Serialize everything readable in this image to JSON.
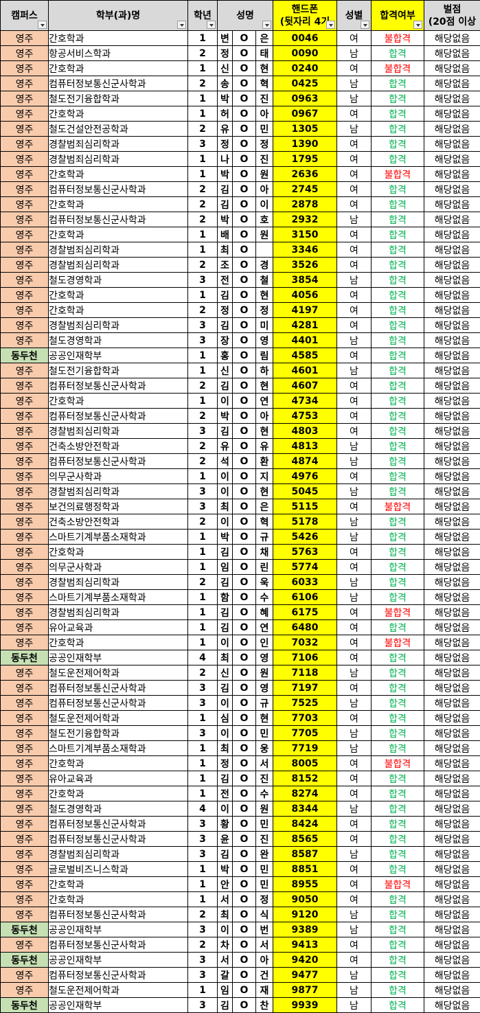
{
  "headers": {
    "campus": "캠퍼스",
    "dept": "학부(과)명",
    "grade": "학년",
    "name": "성명",
    "phone_line1": "핸드폰",
    "phone_line2": "(뒷자리 4기",
    "gender": "성별",
    "result": "합격여부",
    "penalty_line1": "벌점",
    "penalty_line2": "(20점 이상"
  },
  "colors": {
    "yeongju": "#f8cbad",
    "dongducheon": "#c6e0b4",
    "phone": "#ffff00",
    "pass": "#00b050",
    "fail": "#ff0000"
  },
  "rows": [
    {
      "campus": "영주",
      "dept": "간호학과",
      "grade": "1",
      "n1": "변",
      "n2": "O",
      "n3": "은",
      "phone": "0046",
      "gender": "여",
      "result": "불합격",
      "penalty": "해당없음"
    },
    {
      "campus": "영주",
      "dept": "항공서비스학과",
      "grade": "2",
      "n1": "정",
      "n2": "O",
      "n3": "태",
      "phone": "0090",
      "gender": "남",
      "result": "합격",
      "penalty": "해당없음"
    },
    {
      "campus": "영주",
      "dept": "간호학과",
      "grade": "1",
      "n1": "신",
      "n2": "O",
      "n3": "현",
      "phone": "0240",
      "gender": "여",
      "result": "불합격",
      "penalty": "해당없음"
    },
    {
      "campus": "영주",
      "dept": "컴퓨터정보통신군사학과",
      "grade": "2",
      "n1": "송",
      "n2": "O",
      "n3": "혁",
      "phone": "0425",
      "gender": "남",
      "result": "합격",
      "penalty": "해당없음"
    },
    {
      "campus": "영주",
      "dept": "철도전기융합학과",
      "grade": "1",
      "n1": "박",
      "n2": "O",
      "n3": "진",
      "phone": "0963",
      "gender": "남",
      "result": "합격",
      "penalty": "해당없음"
    },
    {
      "campus": "영주",
      "dept": "간호학과",
      "grade": "1",
      "n1": "허",
      "n2": "O",
      "n3": "아",
      "phone": "0967",
      "gender": "여",
      "result": "합격",
      "penalty": "해당없음"
    },
    {
      "campus": "영주",
      "dept": "철도건설안전공학과",
      "grade": "2",
      "n1": "유",
      "n2": "O",
      "n3": "민",
      "phone": "1305",
      "gender": "남",
      "result": "합격",
      "penalty": "해당없음"
    },
    {
      "campus": "영주",
      "dept": "경찰범죄심리학과",
      "grade": "3",
      "n1": "정",
      "n2": "O",
      "n3": "정",
      "phone": "1390",
      "gender": "여",
      "result": "합격",
      "penalty": "해당없음"
    },
    {
      "campus": "영주",
      "dept": "경찰범죄심리학과",
      "grade": "1",
      "n1": "나",
      "n2": "O",
      "n3": "진",
      "phone": "1795",
      "gender": "여",
      "result": "합격",
      "penalty": "해당없음"
    },
    {
      "campus": "영주",
      "dept": "간호학과",
      "grade": "1",
      "n1": "박",
      "n2": "O",
      "n3": "원",
      "phone": "2636",
      "gender": "여",
      "result": "불합격",
      "penalty": "해당없음"
    },
    {
      "campus": "영주",
      "dept": "컴퓨터정보통신군사학과",
      "grade": "2",
      "n1": "김",
      "n2": "O",
      "n3": "아",
      "phone": "2745",
      "gender": "여",
      "result": "합격",
      "penalty": "해당없음"
    },
    {
      "campus": "영주",
      "dept": "간호학과",
      "grade": "2",
      "n1": "김",
      "n2": "O",
      "n3": "이",
      "phone": "2878",
      "gender": "여",
      "result": "합격",
      "penalty": "해당없음"
    },
    {
      "campus": "영주",
      "dept": "컴퓨터정보통신군사학과",
      "grade": "2",
      "n1": "박",
      "n2": "O",
      "n3": "호",
      "phone": "2932",
      "gender": "남",
      "result": "합격",
      "penalty": "해당없음"
    },
    {
      "campus": "영주",
      "dept": "간호학과",
      "grade": "1",
      "n1": "배",
      "n2": "O",
      "n3": "원",
      "phone": "3150",
      "gender": "여",
      "result": "합격",
      "penalty": "해당없음"
    },
    {
      "campus": "영주",
      "dept": "경찰범죄심리학과",
      "grade": "1",
      "n1": "최",
      "n2": "O",
      "n3": "",
      "phone": "3346",
      "gender": "여",
      "result": "합격",
      "penalty": "해당없음"
    },
    {
      "campus": "영주",
      "dept": "경찰범죄심리학과",
      "grade": "2",
      "n1": "조",
      "n2": "O",
      "n3": "경",
      "phone": "3526",
      "gender": "여",
      "result": "합격",
      "penalty": "해당없음"
    },
    {
      "campus": "영주",
      "dept": "철도경영학과",
      "grade": "3",
      "n1": "전",
      "n2": "O",
      "n3": "철",
      "phone": "3854",
      "gender": "남",
      "result": "합격",
      "penalty": "해당없음"
    },
    {
      "campus": "영주",
      "dept": "간호학과",
      "grade": "1",
      "n1": "김",
      "n2": "O",
      "n3": "현",
      "phone": "4056",
      "gender": "여",
      "result": "합격",
      "penalty": "해당없음"
    },
    {
      "campus": "영주",
      "dept": "간호학과",
      "grade": "2",
      "n1": "정",
      "n2": "O",
      "n3": "정",
      "phone": "4197",
      "gender": "여",
      "result": "합격",
      "penalty": "해당없음"
    },
    {
      "campus": "영주",
      "dept": "경찰범죄심리학과",
      "grade": "3",
      "n1": "김",
      "n2": "O",
      "n3": "미",
      "phone": "4281",
      "gender": "여",
      "result": "합격",
      "penalty": "해당없음"
    },
    {
      "campus": "영주",
      "dept": "철도경영학과",
      "grade": "3",
      "n1": "장",
      "n2": "O",
      "n3": "영",
      "phone": "4401",
      "gender": "남",
      "result": "합격",
      "penalty": "해당없음"
    },
    {
      "campus": "동두천",
      "dept": "공공인재학부",
      "grade": "1",
      "n1": "홍",
      "n2": "O",
      "n3": "림",
      "phone": "4585",
      "gender": "여",
      "result": "합격",
      "penalty": "해당없음"
    },
    {
      "campus": "영주",
      "dept": "철도전기융합학과",
      "grade": "1",
      "n1": "신",
      "n2": "O",
      "n3": "하",
      "phone": "4601",
      "gender": "남",
      "result": "합격",
      "penalty": "해당없음"
    },
    {
      "campus": "영주",
      "dept": "컴퓨터정보통신군사학과",
      "grade": "2",
      "n1": "김",
      "n2": "O",
      "n3": "현",
      "phone": "4607",
      "gender": "여",
      "result": "합격",
      "penalty": "해당없음"
    },
    {
      "campus": "영주",
      "dept": "간호학과",
      "grade": "1",
      "n1": "이",
      "n2": "O",
      "n3": "연",
      "phone": "4734",
      "gender": "여",
      "result": "합격",
      "penalty": "해당없음"
    },
    {
      "campus": "영주",
      "dept": "컴퓨터정보통신군사학과",
      "grade": "2",
      "n1": "박",
      "n2": "O",
      "n3": "아",
      "phone": "4753",
      "gender": "여",
      "result": "합격",
      "penalty": "해당없음"
    },
    {
      "campus": "영주",
      "dept": "경찰범죄심리학과",
      "grade": "3",
      "n1": "김",
      "n2": "O",
      "n3": "현",
      "phone": "4803",
      "gender": "여",
      "result": "합격",
      "penalty": "해당없음"
    },
    {
      "campus": "영주",
      "dept": "건축소방안전학과",
      "grade": "2",
      "n1": "유",
      "n2": "O",
      "n3": "유",
      "phone": "4813",
      "gender": "남",
      "result": "합격",
      "penalty": "해당없음"
    },
    {
      "campus": "영주",
      "dept": "컴퓨터정보통신군사학과",
      "grade": "2",
      "n1": "석",
      "n2": "O",
      "n3": "환",
      "phone": "4874",
      "gender": "남",
      "result": "합격",
      "penalty": "해당없음"
    },
    {
      "campus": "영주",
      "dept": "의무군사학과",
      "grade": "1",
      "n1": "이",
      "n2": "O",
      "n3": "지",
      "phone": "4976",
      "gender": "여",
      "result": "합격",
      "penalty": "해당없음"
    },
    {
      "campus": "영주",
      "dept": "경찰범죄심리학과",
      "grade": "3",
      "n1": "이",
      "n2": "O",
      "n3": "현",
      "phone": "5045",
      "gender": "남",
      "result": "합격",
      "penalty": "해당없음"
    },
    {
      "campus": "영주",
      "dept": "보건의료행정학과",
      "grade": "3",
      "n1": "최",
      "n2": "O",
      "n3": "은",
      "phone": "5115",
      "gender": "여",
      "result": "불합격",
      "penalty": "해당없음"
    },
    {
      "campus": "영주",
      "dept": "건축소방안전학과",
      "grade": "2",
      "n1": "이",
      "n2": "O",
      "n3": "혁",
      "phone": "5178",
      "gender": "남",
      "result": "합격",
      "penalty": "해당없음"
    },
    {
      "campus": "영주",
      "dept": "스마트기계부품소재학과",
      "grade": "1",
      "n1": "박",
      "n2": "O",
      "n3": "규",
      "phone": "5426",
      "gender": "남",
      "result": "합격",
      "penalty": "해당없음"
    },
    {
      "campus": "영주",
      "dept": "간호학과",
      "grade": "1",
      "n1": "김",
      "n2": "O",
      "n3": "채",
      "phone": "5763",
      "gender": "여",
      "result": "합격",
      "penalty": "해당없음"
    },
    {
      "campus": "영주",
      "dept": "의무군사학과",
      "grade": "1",
      "n1": "임",
      "n2": "O",
      "n3": "린",
      "phone": "5774",
      "gender": "여",
      "result": "합격",
      "penalty": "해당없음"
    },
    {
      "campus": "영주",
      "dept": "경찰범죄심리학과",
      "grade": "2",
      "n1": "김",
      "n2": "O",
      "n3": "욱",
      "phone": "6033",
      "gender": "남",
      "result": "합격",
      "penalty": "해당없음"
    },
    {
      "campus": "영주",
      "dept": "스마트기계부품소재학과",
      "grade": "1",
      "n1": "함",
      "n2": "O",
      "n3": "수",
      "phone": "6106",
      "gender": "남",
      "result": "합격",
      "penalty": "해당없음"
    },
    {
      "campus": "영주",
      "dept": "경찰범죄심리학과",
      "grade": "1",
      "n1": "김",
      "n2": "O",
      "n3": "혜",
      "phone": "6175",
      "gender": "여",
      "result": "불합격",
      "penalty": "해당없음"
    },
    {
      "campus": "영주",
      "dept": "유아교육과",
      "grade": "1",
      "n1": "김",
      "n2": "O",
      "n3": "연",
      "phone": "6480",
      "gender": "여",
      "result": "합격",
      "penalty": "해당없음"
    },
    {
      "campus": "영주",
      "dept": "간호학과",
      "grade": "1",
      "n1": "이",
      "n2": "O",
      "n3": "인",
      "phone": "7032",
      "gender": "여",
      "result": "불합격",
      "penalty": "해당없음"
    },
    {
      "campus": "동두천",
      "dept": "공공인재학부",
      "grade": "4",
      "n1": "최",
      "n2": "O",
      "n3": "영",
      "phone": "7106",
      "gender": "여",
      "result": "합격",
      "penalty": "해당없음"
    },
    {
      "campus": "영주",
      "dept": "철도운전제어학과",
      "grade": "2",
      "n1": "신",
      "n2": "O",
      "n3": "원",
      "phone": "7118",
      "gender": "남",
      "result": "합격",
      "penalty": "해당없음"
    },
    {
      "campus": "영주",
      "dept": "컴퓨터정보통신군사학과",
      "grade": "3",
      "n1": "김",
      "n2": "O",
      "n3": "영",
      "phone": "7197",
      "gender": "여",
      "result": "합격",
      "penalty": "해당없음"
    },
    {
      "campus": "영주",
      "dept": "컴퓨터정보통신군사학과",
      "grade": "3",
      "n1": "이",
      "n2": "O",
      "n3": "규",
      "phone": "7525",
      "gender": "남",
      "result": "합격",
      "penalty": "해당없음"
    },
    {
      "campus": "영주",
      "dept": "철도운전제어학과",
      "grade": "1",
      "n1": "심",
      "n2": "O",
      "n3": "현",
      "phone": "7703",
      "gender": "여",
      "result": "합격",
      "penalty": "해당없음"
    },
    {
      "campus": "영주",
      "dept": "철도전기융합학과",
      "grade": "3",
      "n1": "이",
      "n2": "O",
      "n3": "민",
      "phone": "7705",
      "gender": "남",
      "result": "합격",
      "penalty": "해당없음"
    },
    {
      "campus": "영주",
      "dept": "스마트기계부품소재학과",
      "grade": "1",
      "n1": "최",
      "n2": "O",
      "n3": "웅",
      "phone": "7719",
      "gender": "남",
      "result": "합격",
      "penalty": "해당없음"
    },
    {
      "campus": "영주",
      "dept": "간호학과",
      "grade": "1",
      "n1": "정",
      "n2": "O",
      "n3": "서",
      "phone": "8005",
      "gender": "여",
      "result": "불합격",
      "penalty": "해당없음"
    },
    {
      "campus": "영주",
      "dept": "유아교육과",
      "grade": "1",
      "n1": "김",
      "n2": "O",
      "n3": "진",
      "phone": "8152",
      "gender": "여",
      "result": "합격",
      "penalty": "해당없음"
    },
    {
      "campus": "영주",
      "dept": "간호학과",
      "grade": "1",
      "n1": "전",
      "n2": "O",
      "n3": "수",
      "phone": "8274",
      "gender": "여",
      "result": "합격",
      "penalty": "해당없음"
    },
    {
      "campus": "영주",
      "dept": "철도경영학과",
      "grade": "4",
      "n1": "이",
      "n2": "O",
      "n3": "원",
      "phone": "8344",
      "gender": "남",
      "result": "합격",
      "penalty": "해당없음"
    },
    {
      "campus": "영주",
      "dept": "컴퓨터정보통신군사학과",
      "grade": "3",
      "n1": "황",
      "n2": "O",
      "n3": "민",
      "phone": "8424",
      "gender": "여",
      "result": "합격",
      "penalty": "해당없음"
    },
    {
      "campus": "영주",
      "dept": "컴퓨터정보통신군사학과",
      "grade": "3",
      "n1": "윤",
      "n2": "O",
      "n3": "진",
      "phone": "8565",
      "gender": "여",
      "result": "합격",
      "penalty": "해당없음"
    },
    {
      "campus": "영주",
      "dept": "경찰범죄심리학과",
      "grade": "3",
      "n1": "김",
      "n2": "O",
      "n3": "완",
      "phone": "8587",
      "gender": "남",
      "result": "합격",
      "penalty": "해당없음"
    },
    {
      "campus": "영주",
      "dept": "글로벌비즈니스학과",
      "grade": "1",
      "n1": "박",
      "n2": "O",
      "n3": "민",
      "phone": "8851",
      "gender": "여",
      "result": "합격",
      "penalty": "해당없음"
    },
    {
      "campus": "영주",
      "dept": "간호학과",
      "grade": "1",
      "n1": "안",
      "n2": "O",
      "n3": "민",
      "phone": "8955",
      "gender": "여",
      "result": "불합격",
      "penalty": "해당없음"
    },
    {
      "campus": "영주",
      "dept": "간호학과",
      "grade": "1",
      "n1": "서",
      "n2": "O",
      "n3": "정",
      "phone": "9050",
      "gender": "여",
      "result": "합격",
      "penalty": "해당없음"
    },
    {
      "campus": "영주",
      "dept": "컴퓨터정보통신군사학과",
      "grade": "2",
      "n1": "최",
      "n2": "O",
      "n3": "식",
      "phone": "9120",
      "gender": "남",
      "result": "합격",
      "penalty": "해당없음"
    },
    {
      "campus": "동두천",
      "dept": "공공인재학부",
      "grade": "3",
      "n1": "이",
      "n2": "O",
      "n3": "번",
      "phone": "9389",
      "gender": "남",
      "result": "합격",
      "penalty": "해당없음"
    },
    {
      "campus": "영주",
      "dept": "컴퓨터정보통신군사학과",
      "grade": "2",
      "n1": "차",
      "n2": "O",
      "n3": "서",
      "phone": "9413",
      "gender": "여",
      "result": "합격",
      "penalty": "해당없음"
    },
    {
      "campus": "동두천",
      "dept": "공공인재학부",
      "grade": "3",
      "n1": "서",
      "n2": "O",
      "n3": "아",
      "phone": "9420",
      "gender": "여",
      "result": "합격",
      "penalty": "해당없음"
    },
    {
      "campus": "영주",
      "dept": "컴퓨터정보통신군사학과",
      "grade": "3",
      "n1": "갈",
      "n2": "O",
      "n3": "건",
      "phone": "9477",
      "gender": "남",
      "result": "합격",
      "penalty": "해당없음"
    },
    {
      "campus": "영주",
      "dept": "철도운전제어학과",
      "grade": "1",
      "n1": "임",
      "n2": "O",
      "n3": "재",
      "phone": "9877",
      "gender": "남",
      "result": "합격",
      "penalty": "해당없음"
    },
    {
      "campus": "동두천",
      "dept": "공공인재학부",
      "grade": "3",
      "n1": "김",
      "n2": "O",
      "n3": "찬",
      "phone": "9939",
      "gender": "남",
      "result": "합격",
      "penalty": "해당없음"
    }
  ]
}
